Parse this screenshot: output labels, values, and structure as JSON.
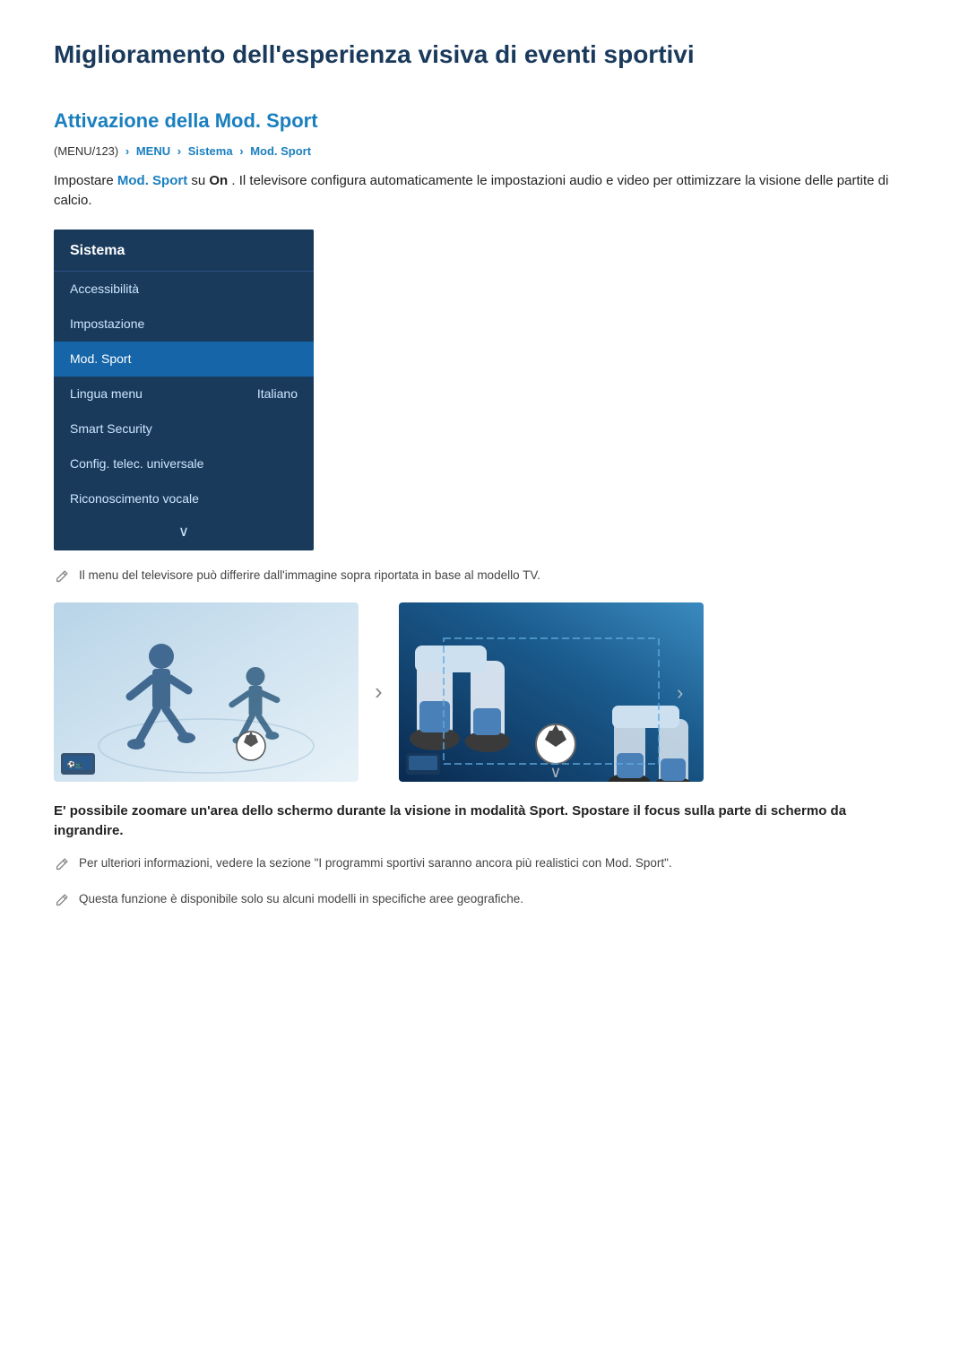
{
  "page": {
    "title": "Miglioramento dell'esperienza visiva di eventi sportivi"
  },
  "section1": {
    "heading": "Attivazione della Mod. Sport",
    "breadcrumb": {
      "part1": "(MENU/123)",
      "arrow1": "›",
      "part2": "MENU",
      "arrow2": "›",
      "part3": "Sistema",
      "arrow3": "›",
      "part4": "Mod. Sport"
    },
    "intro": "Impostare",
    "intro_highlight": "Mod. Sport",
    "intro_mid": " su ",
    "intro_bold": "On",
    "intro_end": ". Il televisore configura automaticamente le impostazioni audio e video per ottimizzare la visione delle partite di calcio."
  },
  "menu": {
    "header": "Sistema",
    "items": [
      {
        "label": "Accessibilità",
        "value": "",
        "selected": false
      },
      {
        "label": "Impostazione",
        "value": "",
        "selected": false
      },
      {
        "label": "Mod. Sport",
        "value": "",
        "selected": true
      },
      {
        "label": "Lingua menu",
        "value": "Italiano",
        "selected": false
      },
      {
        "label": "Smart Security",
        "value": "",
        "selected": false
      },
      {
        "label": "Config. telec. universale",
        "value": "",
        "selected": false
      },
      {
        "label": "Riconoscimento vocale",
        "value": "",
        "selected": false
      }
    ],
    "chevron": "∨"
  },
  "note1": "Il menu del televisore può differire dall'immagine sopra riportata in base al modello TV.",
  "description": "E' possibile zoomare un'area dello schermo durante la visione in modalità Sport. Spostare il focus sulla parte di schermo da ingrandire.",
  "note2": "Per ulteriori informazioni, vedere la sezione \"I programmi sportivi saranno ancora più realistici con Mod. Sport\".",
  "note3": "Questa funzione è disponibile solo su alcuni modelli in specifiche aree geografiche."
}
